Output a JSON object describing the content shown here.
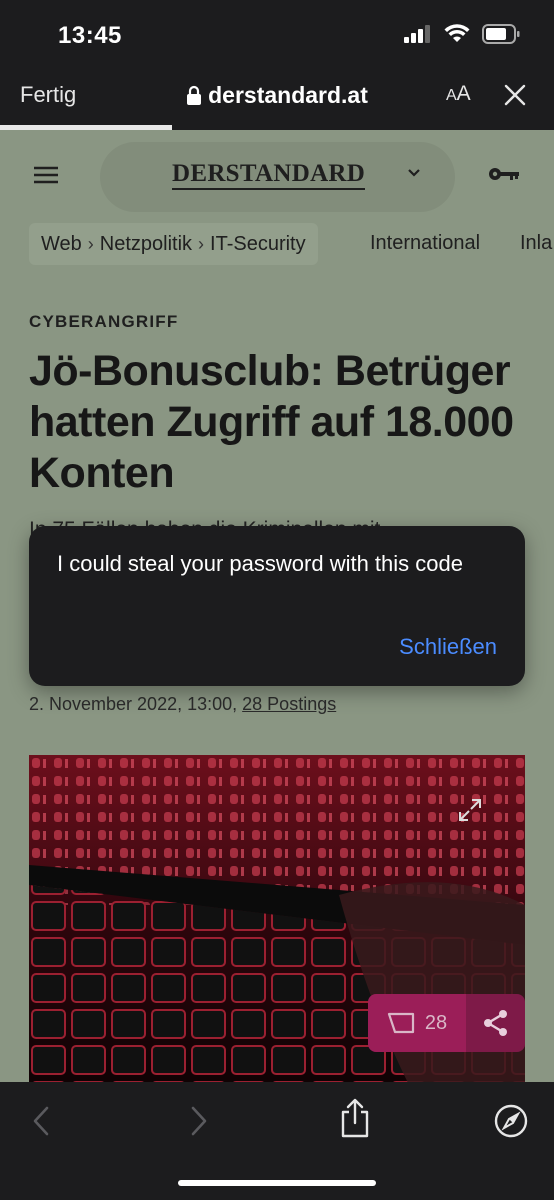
{
  "status_bar": {
    "time": "13:45"
  },
  "browser": {
    "done_label": "Fertig",
    "url": "derstandard.at",
    "text_size_label_small": "A",
    "text_size_label_large": "A",
    "page_load_progress": 0.31
  },
  "site": {
    "logo": "DERSTANDARD",
    "breadcrumb": [
      "Web",
      "Netzpolitik",
      "IT-Security"
    ],
    "nav_items": [
      "International",
      "Inla"
    ]
  },
  "article": {
    "kicker": "CYBERANGRIFF",
    "headline": "Jö-Bonusclub: Betrüger hatten Zugriff auf 18.000 Konten",
    "lead_partial": "In 75 Fällen haben die Kriminellen mit",
    "date": "2. November 2022, 13:00",
    "postings_label": "28 Postings",
    "comment_count": "28"
  },
  "dialog": {
    "message": "I could steal your password with this code",
    "close_label": "Schließen"
  },
  "colors": {
    "background_dimmed": "#8a9683",
    "dialog_bg": "#1c1c1e",
    "link_blue": "#4b8cff",
    "accent_magenta": "#9b1e58"
  }
}
